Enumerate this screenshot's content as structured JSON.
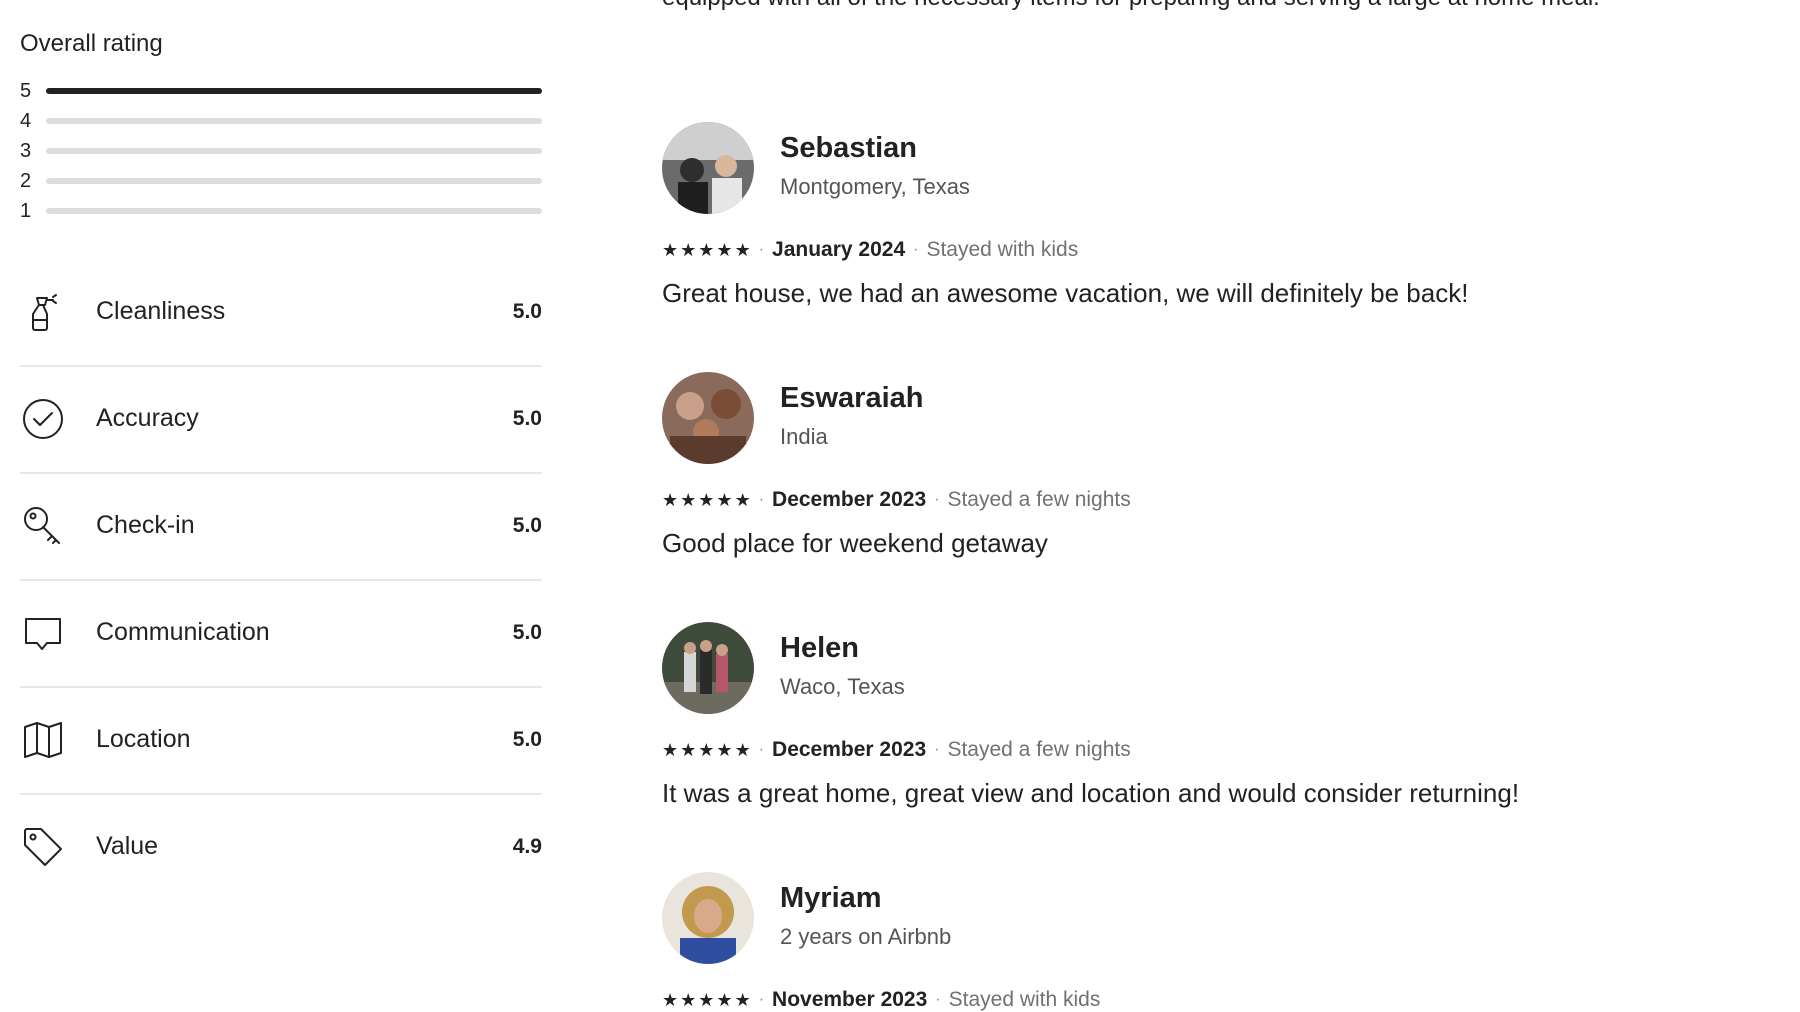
{
  "overall": {
    "title": "Overall rating",
    "distribution": [
      {
        "stars": "5",
        "fraction": 1.0
      },
      {
        "stars": "4",
        "fraction": 0.0
      },
      {
        "stars": "3",
        "fraction": 0.0
      },
      {
        "stars": "2",
        "fraction": 0.0
      },
      {
        "stars": "1",
        "fraction": 0.0
      }
    ]
  },
  "categories": [
    {
      "label": "Cleanliness",
      "score": "5.0",
      "icon": "spray-bottle-icon"
    },
    {
      "label": "Accuracy",
      "score": "5.0",
      "icon": "check-circle-icon"
    },
    {
      "label": "Check-in",
      "score": "5.0",
      "icon": "key-icon"
    },
    {
      "label": "Communication",
      "score": "5.0",
      "icon": "chat-bubble-icon"
    },
    {
      "label": "Location",
      "score": "5.0",
      "icon": "map-icon"
    },
    {
      "label": "Value",
      "score": "4.9",
      "icon": "price-tag-icon"
    }
  ],
  "intro_text": "equipped with all of the necessary items for preparing and serving a large at home meal.",
  "reviews": [
    {
      "name": "Sebastian",
      "subtitle": "Montgomery, Texas",
      "rating": 5,
      "date": "January 2024",
      "stay": "Stayed with kids",
      "text": "Great house, we had an awesome vacation, we will definitely be back!"
    },
    {
      "name": "Eswaraiah",
      "subtitle": "India",
      "rating": 5,
      "date": "December 2023",
      "stay": "Stayed a few nights",
      "text": "Good place for weekend getaway"
    },
    {
      "name": "Helen",
      "subtitle": "Waco, Texas",
      "rating": 5,
      "date": "December 2023",
      "stay": "Stayed a few nights",
      "text": "It was a great home, great view and location and would consider returning!"
    },
    {
      "name": "Myriam",
      "subtitle": "2 years on Airbnb",
      "rating": 5,
      "date": "November 2023",
      "stay": "Stayed with kids",
      "text": ""
    }
  ],
  "glyphs": {
    "star": "★",
    "separator": "·"
  }
}
